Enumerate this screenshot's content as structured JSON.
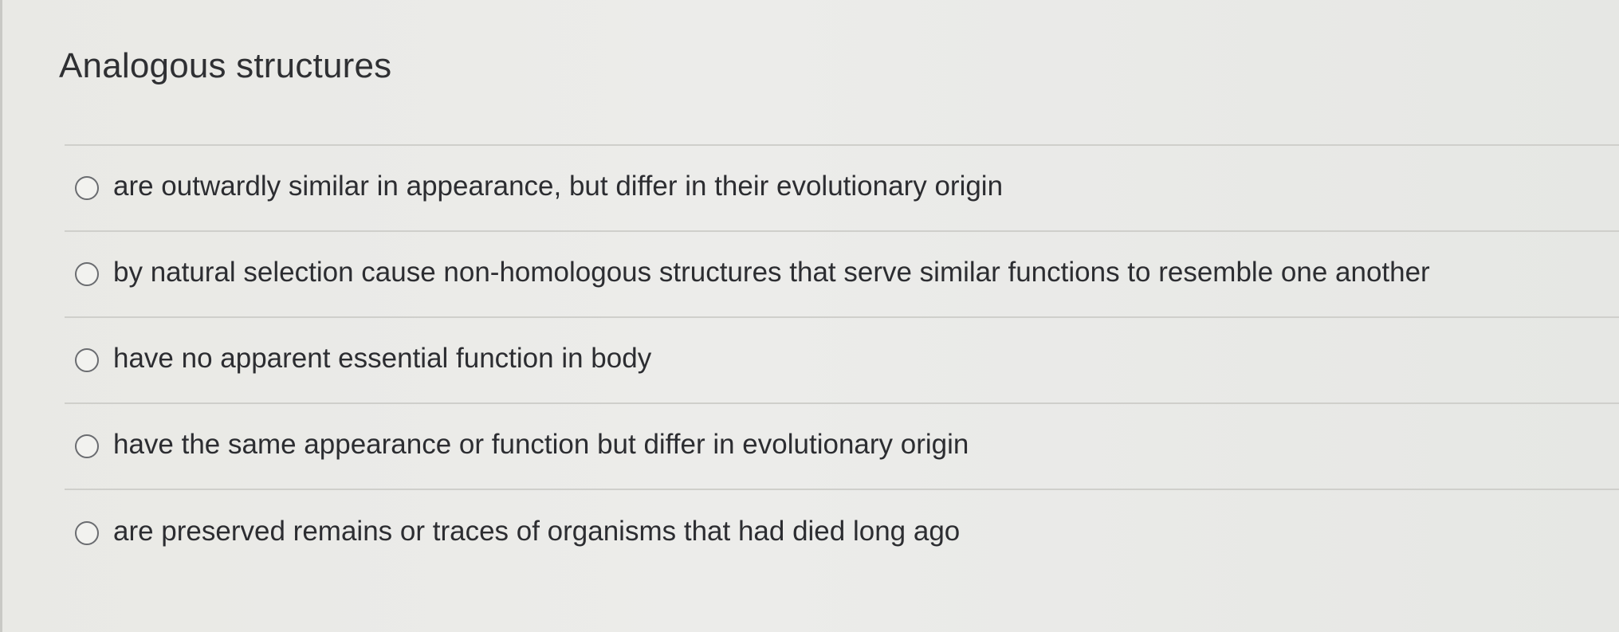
{
  "question": {
    "title": "Analogous structures"
  },
  "options": [
    {
      "label": "are outwardly similar in appearance, but differ in their evolutionary origin",
      "selected": false
    },
    {
      "label": "by natural selection cause non-homologous structures that serve similar functions to resemble one another",
      "selected": false
    },
    {
      "label": "have no apparent essential function in body",
      "selected": false
    },
    {
      "label": "have the same appearance or function but differ in evolutionary origin",
      "selected": false
    },
    {
      "label": "are preserved remains or traces of organisms that had died long ago",
      "selected": false
    }
  ]
}
